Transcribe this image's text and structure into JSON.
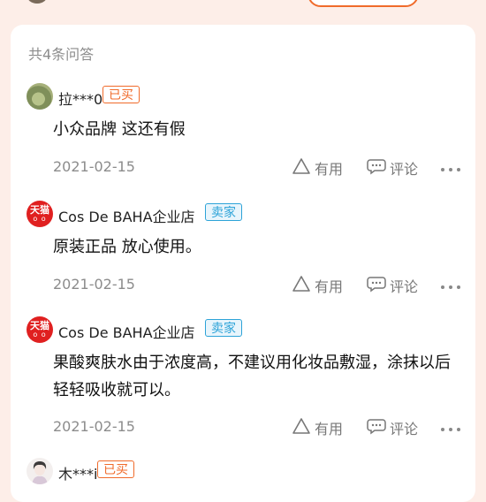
{
  "count_label": "共4条问答",
  "qa": [
    {
      "username": "拉***0",
      "badge": "已买",
      "badge_type": "buyer",
      "content": "小众品牌 这还有假",
      "date": "2021-02-15",
      "useful_label": "有用",
      "comment_label": "评论"
    },
    {
      "username": "Cos De BAHA企业店",
      "badge": "卖家",
      "badge_type": "seller",
      "avatar_text": "天猫",
      "avatar_sub": "o o",
      "content": "原装正品 放心使用。",
      "date": "2021-02-15",
      "useful_label": "有用",
      "comment_label": "评论"
    },
    {
      "username": "Cos De BAHA企业店",
      "badge": "卖家",
      "badge_type": "seller",
      "avatar_text": "天猫",
      "avatar_sub": "o o",
      "content": "果酸爽肤水由于浓度高，不建议用化妆品敷湿，涂抹以后轻轻吸收就可以。",
      "date": "2021-02-15",
      "useful_label": "有用",
      "comment_label": "评论"
    },
    {
      "username": "木***i",
      "badge": "已买",
      "badge_type": "buyer"
    }
  ]
}
